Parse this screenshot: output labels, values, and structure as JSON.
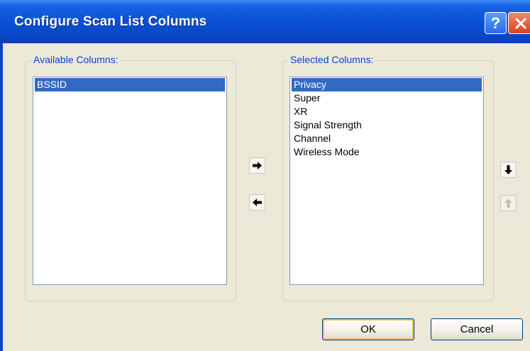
{
  "window": {
    "title": "Configure Scan List Columns"
  },
  "title_buttons": {
    "help_label": "?"
  },
  "available": {
    "label": "Available Columns:",
    "items": [
      "BSSID"
    ],
    "selected_index": 0
  },
  "selected": {
    "label": "Selected Columns:",
    "items": [
      "Privacy",
      "Super",
      "XR",
      "Signal Strength",
      "Channel",
      "Wireless Mode"
    ],
    "selected_index": 0
  },
  "buttons": {
    "ok": "OK",
    "cancel": "Cancel",
    "add_icon": "arrow-right-icon",
    "remove_icon": "arrow-left-icon",
    "move_down_icon": "arrow-down-icon",
    "move_up_icon": "arrow-up-icon"
  },
  "colors": {
    "titlebar": "#0a52d8",
    "selection": "#316ac5",
    "group_label": "#0046d5",
    "dialog_bg": "#ece9d8"
  }
}
